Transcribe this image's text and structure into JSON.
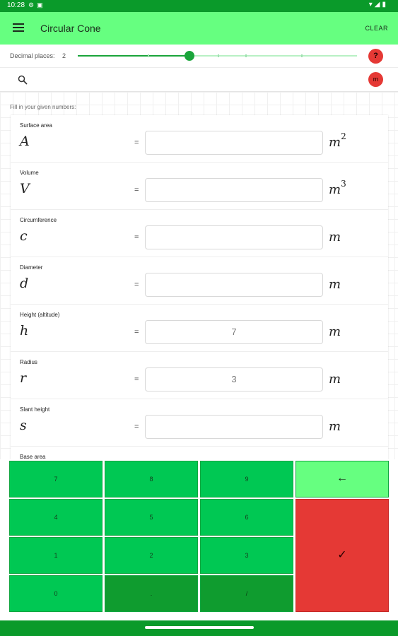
{
  "status_bar": {
    "time": "10:28",
    "left_icons": [
      "gear-icon",
      "notification-icon"
    ],
    "right_icons": [
      "wifi-icon",
      "signal-icon",
      "battery-icon"
    ]
  },
  "app_bar": {
    "title": "Circular Cone",
    "clear_label": "CLEAR"
  },
  "decimal": {
    "label": "Decimal places:",
    "value": "2",
    "slider_fraction": 0.4
  },
  "help": {
    "label": "?"
  },
  "unit": {
    "label": "m"
  },
  "hint": "Fill in your given numbers:",
  "fields": [
    {
      "label": "Surface area",
      "symbol": "A",
      "eq": "=",
      "value": "",
      "unit": "m",
      "exp": "2"
    },
    {
      "label": "Volume",
      "symbol": "V",
      "eq": "=",
      "value": "",
      "unit": "m",
      "exp": "3"
    },
    {
      "label": "Circumference",
      "symbol": "c",
      "eq": "=",
      "value": "",
      "unit": "m",
      "exp": ""
    },
    {
      "label": "Diameter",
      "symbol": "d",
      "eq": "=",
      "value": "",
      "unit": "m",
      "exp": ""
    },
    {
      "label": "Height (altitude)",
      "symbol": "h",
      "eq": "=",
      "value": "7",
      "unit": "m",
      "exp": ""
    },
    {
      "label": "Radius",
      "symbol": "r",
      "eq": "=",
      "value": "3",
      "unit": "m",
      "exp": ""
    },
    {
      "label": "Slant height",
      "symbol": "s",
      "eq": "=",
      "value": "",
      "unit": "m",
      "exp": ""
    },
    {
      "label": "Base area",
      "symbol": "",
      "eq": "",
      "value": "",
      "unit": "",
      "exp": ""
    }
  ],
  "keypad": {
    "keys": [
      "7",
      "8",
      "9",
      "4",
      "5",
      "6",
      "1",
      "2",
      "3",
      "0",
      ".",
      "/"
    ],
    "backspace": "←",
    "confirm": "✓"
  },
  "colors": {
    "status_bar": "#0a9a2a",
    "app_bar": "#66ff80",
    "accent": "#1aa53b",
    "key_light": "#00c853",
    "key_dark": "#0f9c2f",
    "danger": "#e53935"
  }
}
